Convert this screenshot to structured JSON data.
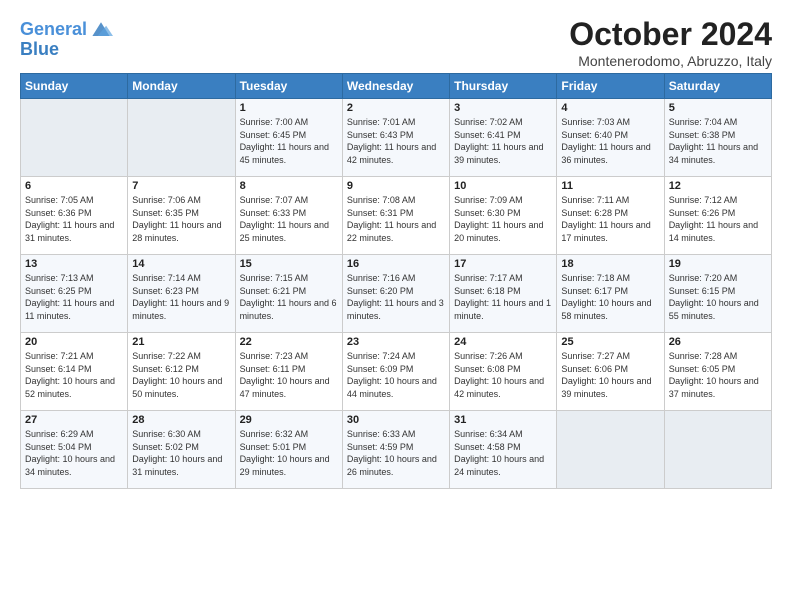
{
  "logo": {
    "line1": "General",
    "line2": "Blue"
  },
  "title": "October 2024",
  "location": "Montenerodomo, Abruzzo, Italy",
  "days_of_week": [
    "Sunday",
    "Monday",
    "Tuesday",
    "Wednesday",
    "Thursday",
    "Friday",
    "Saturday"
  ],
  "weeks": [
    [
      {
        "day": "",
        "sunrise": "",
        "sunset": "",
        "daylight": ""
      },
      {
        "day": "",
        "sunrise": "",
        "sunset": "",
        "daylight": ""
      },
      {
        "day": "1",
        "sunrise": "Sunrise: 7:00 AM",
        "sunset": "Sunset: 6:45 PM",
        "daylight": "Daylight: 11 hours and 45 minutes."
      },
      {
        "day": "2",
        "sunrise": "Sunrise: 7:01 AM",
        "sunset": "Sunset: 6:43 PM",
        "daylight": "Daylight: 11 hours and 42 minutes."
      },
      {
        "day": "3",
        "sunrise": "Sunrise: 7:02 AM",
        "sunset": "Sunset: 6:41 PM",
        "daylight": "Daylight: 11 hours and 39 minutes."
      },
      {
        "day": "4",
        "sunrise": "Sunrise: 7:03 AM",
        "sunset": "Sunset: 6:40 PM",
        "daylight": "Daylight: 11 hours and 36 minutes."
      },
      {
        "day": "5",
        "sunrise": "Sunrise: 7:04 AM",
        "sunset": "Sunset: 6:38 PM",
        "daylight": "Daylight: 11 hours and 34 minutes."
      }
    ],
    [
      {
        "day": "6",
        "sunrise": "Sunrise: 7:05 AM",
        "sunset": "Sunset: 6:36 PM",
        "daylight": "Daylight: 11 hours and 31 minutes."
      },
      {
        "day": "7",
        "sunrise": "Sunrise: 7:06 AM",
        "sunset": "Sunset: 6:35 PM",
        "daylight": "Daylight: 11 hours and 28 minutes."
      },
      {
        "day": "8",
        "sunrise": "Sunrise: 7:07 AM",
        "sunset": "Sunset: 6:33 PM",
        "daylight": "Daylight: 11 hours and 25 minutes."
      },
      {
        "day": "9",
        "sunrise": "Sunrise: 7:08 AM",
        "sunset": "Sunset: 6:31 PM",
        "daylight": "Daylight: 11 hours and 22 minutes."
      },
      {
        "day": "10",
        "sunrise": "Sunrise: 7:09 AM",
        "sunset": "Sunset: 6:30 PM",
        "daylight": "Daylight: 11 hours and 20 minutes."
      },
      {
        "day": "11",
        "sunrise": "Sunrise: 7:11 AM",
        "sunset": "Sunset: 6:28 PM",
        "daylight": "Daylight: 11 hours and 17 minutes."
      },
      {
        "day": "12",
        "sunrise": "Sunrise: 7:12 AM",
        "sunset": "Sunset: 6:26 PM",
        "daylight": "Daylight: 11 hours and 14 minutes."
      }
    ],
    [
      {
        "day": "13",
        "sunrise": "Sunrise: 7:13 AM",
        "sunset": "Sunset: 6:25 PM",
        "daylight": "Daylight: 11 hours and 11 minutes."
      },
      {
        "day": "14",
        "sunrise": "Sunrise: 7:14 AM",
        "sunset": "Sunset: 6:23 PM",
        "daylight": "Daylight: 11 hours and 9 minutes."
      },
      {
        "day": "15",
        "sunrise": "Sunrise: 7:15 AM",
        "sunset": "Sunset: 6:21 PM",
        "daylight": "Daylight: 11 hours and 6 minutes."
      },
      {
        "day": "16",
        "sunrise": "Sunrise: 7:16 AM",
        "sunset": "Sunset: 6:20 PM",
        "daylight": "Daylight: 11 hours and 3 minutes."
      },
      {
        "day": "17",
        "sunrise": "Sunrise: 7:17 AM",
        "sunset": "Sunset: 6:18 PM",
        "daylight": "Daylight: 11 hours and 1 minute."
      },
      {
        "day": "18",
        "sunrise": "Sunrise: 7:18 AM",
        "sunset": "Sunset: 6:17 PM",
        "daylight": "Daylight: 10 hours and 58 minutes."
      },
      {
        "day": "19",
        "sunrise": "Sunrise: 7:20 AM",
        "sunset": "Sunset: 6:15 PM",
        "daylight": "Daylight: 10 hours and 55 minutes."
      }
    ],
    [
      {
        "day": "20",
        "sunrise": "Sunrise: 7:21 AM",
        "sunset": "Sunset: 6:14 PM",
        "daylight": "Daylight: 10 hours and 52 minutes."
      },
      {
        "day": "21",
        "sunrise": "Sunrise: 7:22 AM",
        "sunset": "Sunset: 6:12 PM",
        "daylight": "Daylight: 10 hours and 50 minutes."
      },
      {
        "day": "22",
        "sunrise": "Sunrise: 7:23 AM",
        "sunset": "Sunset: 6:11 PM",
        "daylight": "Daylight: 10 hours and 47 minutes."
      },
      {
        "day": "23",
        "sunrise": "Sunrise: 7:24 AM",
        "sunset": "Sunset: 6:09 PM",
        "daylight": "Daylight: 10 hours and 44 minutes."
      },
      {
        "day": "24",
        "sunrise": "Sunrise: 7:26 AM",
        "sunset": "Sunset: 6:08 PM",
        "daylight": "Daylight: 10 hours and 42 minutes."
      },
      {
        "day": "25",
        "sunrise": "Sunrise: 7:27 AM",
        "sunset": "Sunset: 6:06 PM",
        "daylight": "Daylight: 10 hours and 39 minutes."
      },
      {
        "day": "26",
        "sunrise": "Sunrise: 7:28 AM",
        "sunset": "Sunset: 6:05 PM",
        "daylight": "Daylight: 10 hours and 37 minutes."
      }
    ],
    [
      {
        "day": "27",
        "sunrise": "Sunrise: 6:29 AM",
        "sunset": "Sunset: 5:04 PM",
        "daylight": "Daylight: 10 hours and 34 minutes."
      },
      {
        "day": "28",
        "sunrise": "Sunrise: 6:30 AM",
        "sunset": "Sunset: 5:02 PM",
        "daylight": "Daylight: 10 hours and 31 minutes."
      },
      {
        "day": "29",
        "sunrise": "Sunrise: 6:32 AM",
        "sunset": "Sunset: 5:01 PM",
        "daylight": "Daylight: 10 hours and 29 minutes."
      },
      {
        "day": "30",
        "sunrise": "Sunrise: 6:33 AM",
        "sunset": "Sunset: 4:59 PM",
        "daylight": "Daylight: 10 hours and 26 minutes."
      },
      {
        "day": "31",
        "sunrise": "Sunrise: 6:34 AM",
        "sunset": "Sunset: 4:58 PM",
        "daylight": "Daylight: 10 hours and 24 minutes."
      },
      {
        "day": "",
        "sunrise": "",
        "sunset": "",
        "daylight": ""
      },
      {
        "day": "",
        "sunrise": "",
        "sunset": "",
        "daylight": ""
      }
    ]
  ]
}
